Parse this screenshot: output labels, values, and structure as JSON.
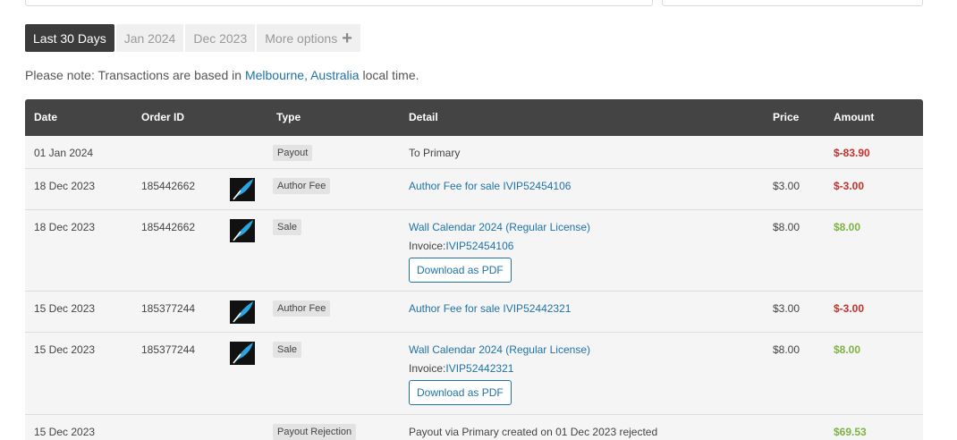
{
  "tabs": [
    {
      "label": "Last 30 Days"
    },
    {
      "label": "Jan 2024"
    },
    {
      "label": "Dec 2023"
    },
    {
      "label": "More options"
    }
  ],
  "note": {
    "prefix": "Please note: Transactions are based in ",
    "location": "Melbourne, Australia",
    "suffix": " local time."
  },
  "table": {
    "headers": {
      "date": "Date",
      "order": "Order ID",
      "type": "Type",
      "detail": "Detail",
      "price": "Price",
      "amount": "Amount"
    },
    "rows": [
      {
        "date": "01 Jan 2024",
        "order": "",
        "type": "Payout",
        "detail": "To Primary",
        "price": "",
        "amount": "$-83.90"
      },
      {
        "date": "18 Dec 2023",
        "order": "185442662",
        "type": "Author Fee",
        "detail": "Author Fee for sale IVIP52454106",
        "price": "$3.00",
        "amount": "$-3.00"
      },
      {
        "date": "18 Dec 2023",
        "order": "185442662",
        "type": "Sale",
        "detail": "Wall Calendar 2024 (Regular License)",
        "invoice_label": "Invoice:",
        "invoice_id": "IVIP52454106",
        "pdf_label": "Download as PDF",
        "price": "$8.00",
        "amount": "$8.00"
      },
      {
        "date": "15 Dec 2023",
        "order": "185377244",
        "type": "Author Fee",
        "detail": "Author Fee for sale IVIP52442321",
        "price": "$3.00",
        "amount": "$-3.00"
      },
      {
        "date": "15 Dec 2023",
        "order": "185377244",
        "type": "Sale",
        "detail": "Wall Calendar 2024 (Regular License)",
        "invoice_label": "Invoice:",
        "invoice_id": "IVIP52442321",
        "pdf_label": "Download as PDF",
        "price": "$8.00",
        "amount": "$8.00"
      },
      {
        "date": "15 Dec 2023",
        "order": "",
        "type": "Payout Rejection",
        "detail": "Payout via Primary created on 01 Dec 2023 rejected",
        "price": "",
        "amount": "$69.53"
      }
    ]
  },
  "colors": {
    "header_bg": "#444444",
    "negative": "#c9302c",
    "positive": "#7cb342",
    "link": "#1f73a8"
  },
  "icons": {
    "item_thumbnail": "blue-feather-icon",
    "more_options": "plus-icon"
  }
}
